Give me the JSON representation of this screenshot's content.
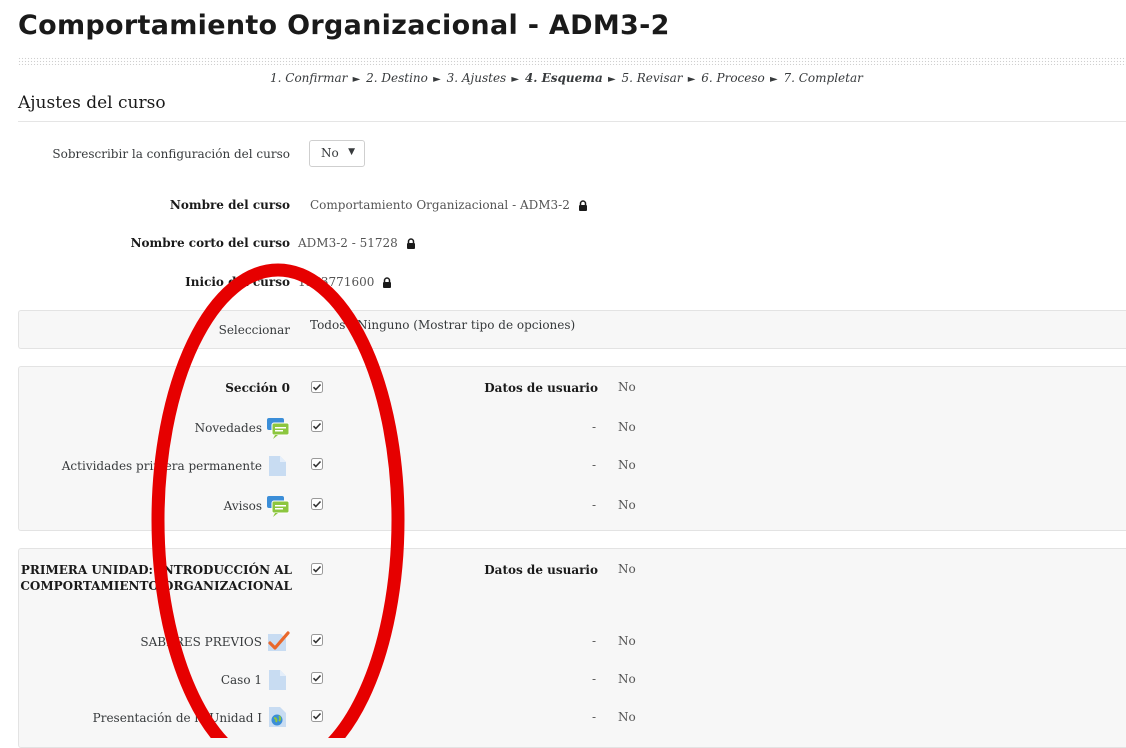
{
  "title": "Comportamiento Organizacional - ADM3-2",
  "steps": [
    {
      "label": "1. Confirmar"
    },
    {
      "label": "2. Destino"
    },
    {
      "label": "3. Ajustes"
    },
    {
      "label": "4. Esquema",
      "current": true
    },
    {
      "label": "5. Revisar"
    },
    {
      "label": "6. Proceso"
    },
    {
      "label": "7. Completar"
    }
  ],
  "section_heading": "Ajustes del curso",
  "settings": {
    "overwrite_label": "Sobrescribir la configuración del curso",
    "overwrite_value": "No",
    "course_name_label": "Nombre del curso",
    "course_name_value": "Comportamiento Organizacional - ADM3-2",
    "short_name_label": "Nombre corto del curso",
    "short_name_value": "ADM3-2 - 51728",
    "start_label": "Inicio del curso",
    "start_value": "1563771600"
  },
  "select_row": {
    "label": "Seleccionar",
    "value": "Todos / Ninguno (Mostrar tipo de opciones)"
  },
  "section0": {
    "title": "Sección 0",
    "userdata_label": "Datos de usuario",
    "userdata_value": "No",
    "items": [
      {
        "label": "Novedades",
        "icon": "forum-icon",
        "dash": "-",
        "value": "No"
      },
      {
        "label": "Actividades primera permanente",
        "icon": "page-icon",
        "dash": "-",
        "value": "No"
      },
      {
        "label": "Avisos",
        "icon": "forum-icon",
        "dash": "-",
        "value": "No"
      }
    ]
  },
  "section1": {
    "title": "PRIMERA UNIDAD: INTRODUCCIÓN AL COMPORTAMIENTO ORGANIZACIONAL",
    "userdata_label": "Datos de usuario",
    "userdata_value": "No",
    "items": [
      {
        "label": "SABERES PREVIOS",
        "icon": "quiz-icon",
        "dash": "-",
        "value": "No"
      },
      {
        "label": "Caso 1",
        "icon": "page-icon",
        "dash": "-",
        "value": "No"
      },
      {
        "label": "Presentación de la Unidad I",
        "icon": "url-icon",
        "dash": "-",
        "value": "No"
      }
    ]
  },
  "colors": {
    "annotation": "#e60000",
    "forum": "#3b8ed8",
    "forum_inner": "#8cc63f",
    "page": "#c8dcf2",
    "quiz_check": "#e9682c"
  }
}
